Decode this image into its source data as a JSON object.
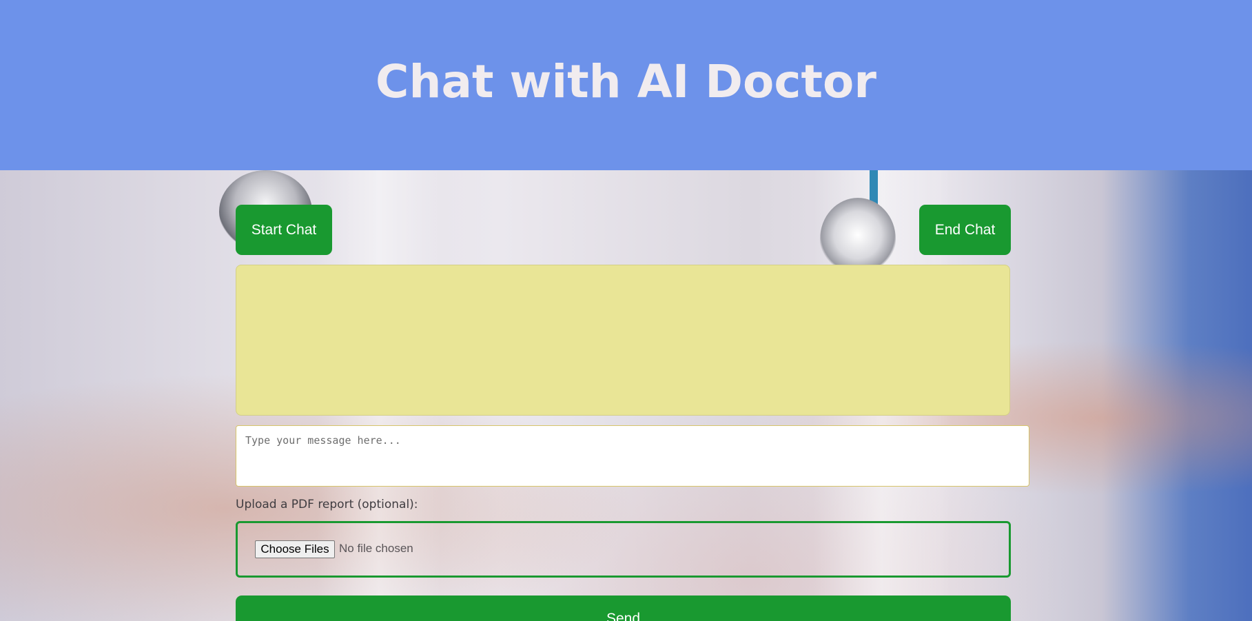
{
  "header": {
    "title": "Chat with AI Doctor",
    "background_color": "#6d92ea"
  },
  "controls": {
    "start_chat_label": "Start Chat",
    "end_chat_label": "End Chat",
    "button_color": "#199930"
  },
  "chat": {
    "messages": [],
    "background_color": "#e9e596"
  },
  "message_input": {
    "placeholder": "Type your message here...",
    "value": ""
  },
  "upload": {
    "label": "Upload a PDF report (optional):",
    "choose_button_label": "Choose Files",
    "status": "No file chosen"
  },
  "send": {
    "label": "Send"
  }
}
